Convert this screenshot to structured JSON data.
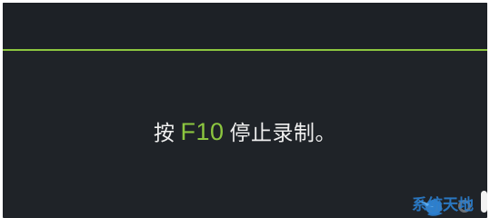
{
  "overlay": {
    "message_prefix": "按",
    "hotkey": "F10",
    "message_suffix": "停止录制。"
  },
  "watermark": {
    "text": "系统天地"
  },
  "colors": {
    "background": "#1f2328",
    "accent": "#8cc63f",
    "text": "#f0f0f0",
    "watermark": "#2b7fd0"
  },
  "icons": {
    "record_status": "ring-icon",
    "bar_handle": "pill-icon",
    "watermark_logo": "bird-logo"
  }
}
